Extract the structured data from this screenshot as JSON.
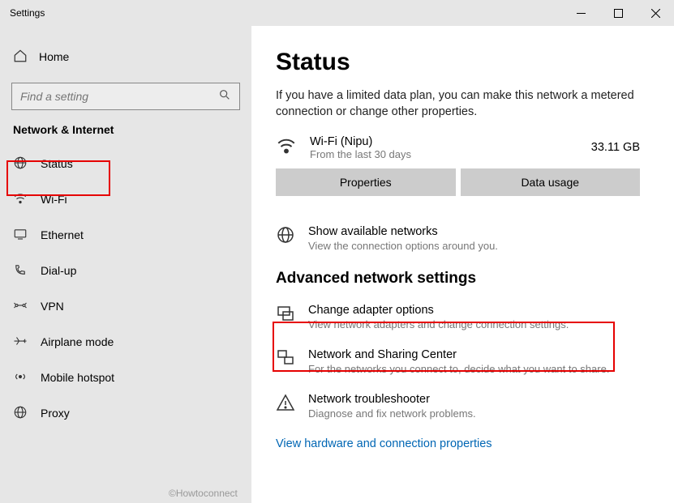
{
  "window": {
    "title": "Settings"
  },
  "sidebar": {
    "home_label": "Home",
    "search_placeholder": "Find a setting",
    "section_label": "Network & Internet",
    "items": [
      {
        "label": "Status"
      },
      {
        "label": "Wi-Fi"
      },
      {
        "label": "Ethernet"
      },
      {
        "label": "Dial-up"
      },
      {
        "label": "VPN"
      },
      {
        "label": "Airplane mode"
      },
      {
        "label": "Mobile hotspot"
      },
      {
        "label": "Proxy"
      }
    ]
  },
  "main": {
    "heading": "Status",
    "lead": "If you have a limited data plan, you can make this network a metered connection or change other properties.",
    "connection": {
      "name": "Wi-Fi (Nipu)",
      "subtitle": "From the last 30 days",
      "usage": "33.11 GB"
    },
    "buttons": {
      "properties": "Properties",
      "data_usage": "Data usage"
    },
    "available": {
      "title": "Show available networks",
      "desc": "View the connection options around you."
    },
    "advanced_heading": "Advanced network settings",
    "adv": [
      {
        "title": "Change adapter options",
        "desc": "View network adapters and change connection settings."
      },
      {
        "title": "Network and Sharing Center",
        "desc": "For the networks you connect to, decide what you want to share."
      },
      {
        "title": "Network troubleshooter",
        "desc": "Diagnose and fix network problems."
      }
    ],
    "link": "View hardware and connection properties"
  },
  "watermark": "©Howtoconnect"
}
